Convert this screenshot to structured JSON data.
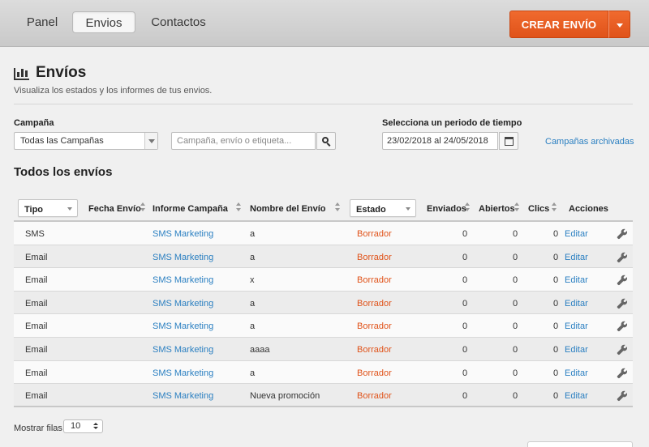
{
  "nav": {
    "tabs": [
      {
        "label": "Panel",
        "active": false
      },
      {
        "label": "Envios",
        "active": true
      },
      {
        "label": "Contactos",
        "active": false
      }
    ],
    "create_button": "CREAR ENVÍO"
  },
  "header": {
    "title": "Envíos",
    "subtitle": "Visualiza los estados y los informes de tus envios."
  },
  "filters": {
    "campaign_label": "Campaña",
    "campaign_value": "Todas las Campañas",
    "search_placeholder": "Campaña, envío o etiqueta...",
    "period_label": "Selecciona un periodo de tiempo",
    "period_value": "23/02/2018 al 24/05/2018",
    "archived_link": "Campañas archivadas"
  },
  "section_title": "Todos los envíos",
  "table": {
    "columns": {
      "tipo": "Tipo",
      "fecha": "Fecha Envío",
      "informe": "Informe Campaña",
      "nombre": "Nombre del Envío",
      "estado": "Estado",
      "enviados": "Enviados",
      "abiertos": "Abiertos",
      "clics": "Clics",
      "acciones": "Acciones"
    },
    "rows": [
      {
        "tipo": "SMS",
        "informe": "SMS Marketing",
        "nombre": "a",
        "estado": "Borrador",
        "enviados": "0",
        "abiertos": "0",
        "clics": "0",
        "accion": "Editar"
      },
      {
        "tipo": "Email",
        "informe": "SMS Marketing",
        "nombre": "a",
        "estado": "Borrador",
        "enviados": "0",
        "abiertos": "0",
        "clics": "0",
        "accion": "Editar"
      },
      {
        "tipo": "Email",
        "informe": "SMS Marketing",
        "nombre": "x",
        "estado": "Borrador",
        "enviados": "0",
        "abiertos": "0",
        "clics": "0",
        "accion": "Editar"
      },
      {
        "tipo": "Email",
        "informe": "SMS Marketing",
        "nombre": "a",
        "estado": "Borrador",
        "enviados": "0",
        "abiertos": "0",
        "clics": "0",
        "accion": "Editar"
      },
      {
        "tipo": "Email",
        "informe": "SMS Marketing",
        "nombre": "a",
        "estado": "Borrador",
        "enviados": "0",
        "abiertos": "0",
        "clics": "0",
        "accion": "Editar"
      },
      {
        "tipo": "Email",
        "informe": "SMS Marketing",
        "nombre": "aaaa",
        "estado": "Borrador",
        "enviados": "0",
        "abiertos": "0",
        "clics": "0",
        "accion": "Editar"
      },
      {
        "tipo": "Email",
        "informe": "SMS Marketing",
        "nombre": "a",
        "estado": "Borrador",
        "enviados": "0",
        "abiertos": "0",
        "clics": "0",
        "accion": "Editar"
      },
      {
        "tipo": "Email",
        "informe": "SMS Marketing",
        "nombre": "Nueva promoción",
        "estado": "Borrador",
        "enviados": "0",
        "abiertos": "0",
        "clics": "0",
        "accion": "Editar"
      }
    ]
  },
  "pagination": {
    "rows_label": "Mostrar filas",
    "rows_value": "10"
  },
  "colors": {
    "accent": "#e8591f",
    "link": "#2a7fc1",
    "status_draft": "#e0531a"
  }
}
